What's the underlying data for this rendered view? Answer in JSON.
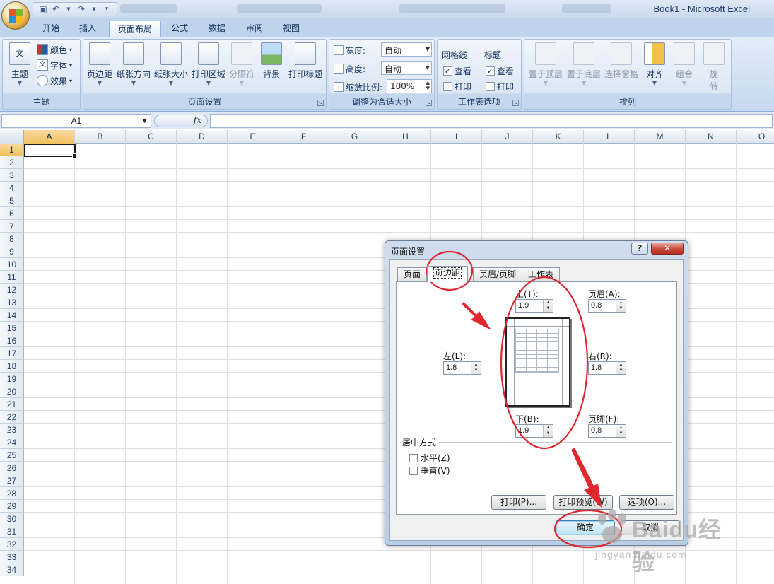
{
  "window": {
    "title": "Book1 - Microsoft Excel"
  },
  "tabs": [
    "开始",
    "插入",
    "页面布局",
    "公式",
    "数据",
    "审阅",
    "视图"
  ],
  "ribbon": {
    "theme_group": {
      "label": "主题",
      "themes_button": "主题",
      "colors": "颜色",
      "fonts": "字体",
      "effects": "效果"
    },
    "page_setup_group": {
      "label": "页面设置",
      "buttons": [
        "页边距",
        "纸张方向",
        "纸张大小",
        "打印区域",
        "分隔符",
        "背景",
        "打印标题"
      ]
    },
    "scale_group": {
      "label": "调整为合适大小",
      "width_label": "宽度:",
      "width_value": "自动",
      "height_label": "高度:",
      "height_value": "自动",
      "scale_label": "缩放比例:",
      "scale_value": "100%"
    },
    "sheet_options_group": {
      "label": "工作表选项",
      "gridlines": "网格线",
      "headings": "标题",
      "view": "查看",
      "print": "打印"
    },
    "arrange_group": {
      "label": "排列",
      "buttons": [
        "置于顶层",
        "置于底层",
        "选择窗格",
        "对齐",
        "组合"
      ],
      "rotate_top": "旋",
      "rotate_bottom": "转"
    }
  },
  "formula_bar": {
    "name_box": "A1",
    "fx": "fx"
  },
  "grid": {
    "columns": [
      "A",
      "B",
      "C",
      "D",
      "E",
      "F",
      "G",
      "H",
      "I",
      "J",
      "K",
      "L",
      "M",
      "N",
      "O"
    ],
    "rows": [
      "1",
      "2",
      "3",
      "4",
      "5",
      "6",
      "7",
      "8",
      "9",
      "10",
      "11",
      "12",
      "13",
      "14",
      "15",
      "16",
      "17",
      "18",
      "19",
      "20",
      "21",
      "22",
      "23",
      "24",
      "25",
      "26",
      "27",
      "28",
      "29",
      "30",
      "31",
      "32",
      "33",
      "34"
    ]
  },
  "dialog": {
    "title": "页面设置",
    "help": "?",
    "close": "✕",
    "tabs": [
      "页面",
      "页边距",
      "页眉/页脚",
      "工作表"
    ],
    "top_label": "上(T):",
    "top_value": "1.9",
    "header_label": "页眉(A):",
    "header_value": "0.8",
    "left_label": "左(L):",
    "left_value": "1.8",
    "right_label": "右(R):",
    "right_value": "1.8",
    "bottom_label": "下(B):",
    "bottom_value": "1.9",
    "footer_label": "页脚(F):",
    "footer_value": "0.8",
    "center_on_page": "居中方式",
    "horizontally": "水平(Z)",
    "vertically": "垂直(V)",
    "print_button": "打印(P)...",
    "print_preview_button": "打印预览(W)",
    "options_button": "选项(O)...",
    "ok_button": "确定",
    "cancel_button": "取消"
  },
  "watermark": {
    "main": "Baidu经验",
    "sub": "jingyan.baidu.com"
  },
  "colors": {
    "annotation": "#e0262f",
    "ribbon_text": "#15325e",
    "selection_header": "#f1c15f"
  }
}
